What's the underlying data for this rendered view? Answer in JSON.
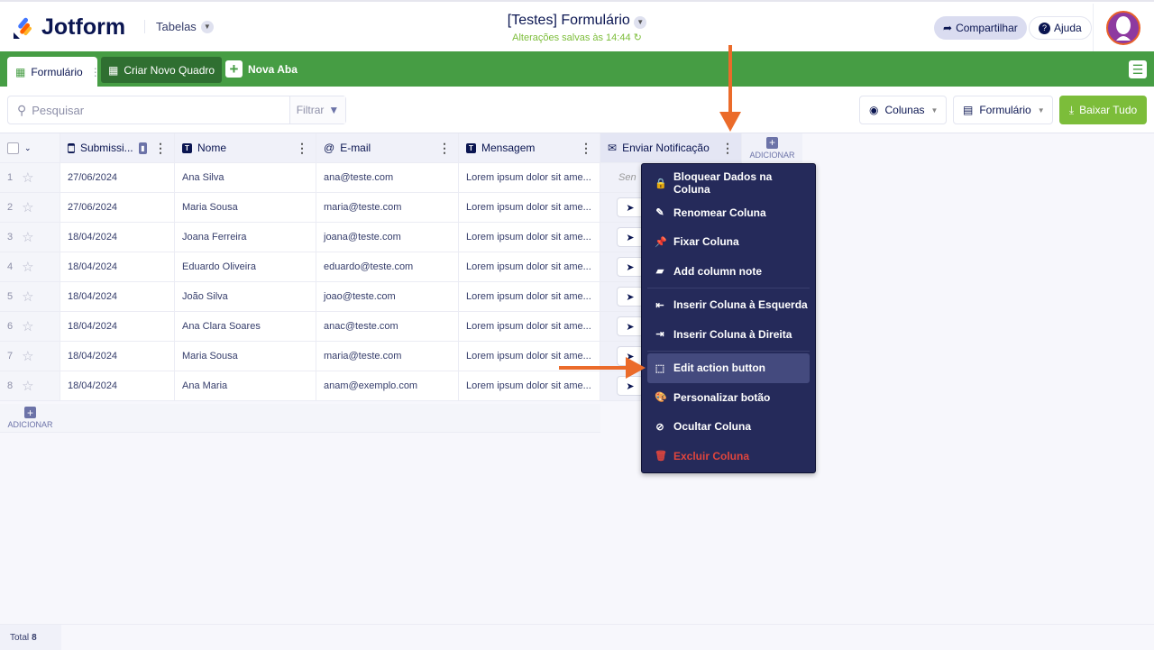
{
  "header": {
    "logo": "Jotform",
    "tables": "Tabelas",
    "title": "[Testes] Formulário",
    "saved": "Alterações salvas às 14:44",
    "share": "Compartilhar",
    "help": "Ajuda"
  },
  "tabs": {
    "active": "Formulário",
    "new_board": "Criar Novo Quadro",
    "new_tab": "Nova Aba"
  },
  "toolbar": {
    "search_placeholder": "Pesquisar",
    "filter": "Filtrar",
    "columns": "Colunas",
    "form": "Formulário",
    "download": "Baixar Tudo"
  },
  "table": {
    "columns": [
      "Submissi...",
      "Nome",
      "E-mail",
      "Mensagem",
      "Enviar Notificação"
    ],
    "add_label": "ADICIONAR",
    "send_placeholder": "Sen",
    "rows": [
      {
        "n": "1",
        "date": "27/06/2024",
        "name": "Ana Silva",
        "email": "ana@teste.com",
        "msg": "Lorem ipsum dolor sit ame..."
      },
      {
        "n": "2",
        "date": "27/06/2024",
        "name": "Maria Sousa",
        "email": "maria@teste.com",
        "msg": "Lorem ipsum dolor sit ame..."
      },
      {
        "n": "3",
        "date": "18/04/2024",
        "name": "Joana Ferreira",
        "email": "joana@teste.com",
        "msg": "Lorem ipsum dolor sit ame..."
      },
      {
        "n": "4",
        "date": "18/04/2024",
        "name": "Eduardo Oliveira",
        "email": "eduardo@teste.com",
        "msg": "Lorem ipsum dolor sit ame..."
      },
      {
        "n": "5",
        "date": "18/04/2024",
        "name": "João Silva",
        "email": "joao@teste.com",
        "msg": "Lorem ipsum dolor sit ame..."
      },
      {
        "n": "6",
        "date": "18/04/2024",
        "name": "Ana Clara Soares",
        "email": "anac@teste.com",
        "msg": "Lorem ipsum dolor sit ame..."
      },
      {
        "n": "7",
        "date": "18/04/2024",
        "name": "Maria Sousa",
        "email": "maria@teste.com",
        "msg": "Lorem ipsum dolor sit ame..."
      },
      {
        "n": "8",
        "date": "18/04/2024",
        "name": "Ana Maria",
        "email": "anam@exemplo.com",
        "msg": "Lorem ipsum dolor sit ame..."
      }
    ]
  },
  "menu": {
    "items": [
      {
        "label": "Bloquear Dados na Coluna",
        "icon": "lock-icon",
        "g": "🔒"
      },
      {
        "label": "Renomear Coluna",
        "icon": "pencil-icon",
        "g": "✎"
      },
      {
        "label": "Fixar Coluna",
        "icon": "pin-icon",
        "g": "📌"
      },
      {
        "label": "Add column note",
        "icon": "note-icon",
        "g": "▰"
      },
      {
        "label": "Inserir Coluna à Esquerda",
        "icon": "insert-left-icon",
        "g": "⇤"
      },
      {
        "label": "Inserir Coluna à Direita",
        "icon": "insert-right-icon",
        "g": "⇥"
      },
      {
        "label": "Edit action button",
        "icon": "edit-action-icon",
        "g": "⬚"
      },
      {
        "label": "Personalizar botão",
        "icon": "palette-icon",
        "g": "🎨"
      },
      {
        "label": "Ocultar Coluna",
        "icon": "eye-off-icon",
        "g": "⊘"
      },
      {
        "label": "Excluir Coluna",
        "icon": "trash-icon",
        "g": "🗑"
      }
    ]
  },
  "footer": {
    "total_label": "Total",
    "total": "8"
  },
  "colors": {
    "green": "#469d44",
    "accent": "#7cbd3a",
    "menu_bg": "#252a5a",
    "arrow": "#eb6b2a",
    "danger": "#e0453d"
  }
}
